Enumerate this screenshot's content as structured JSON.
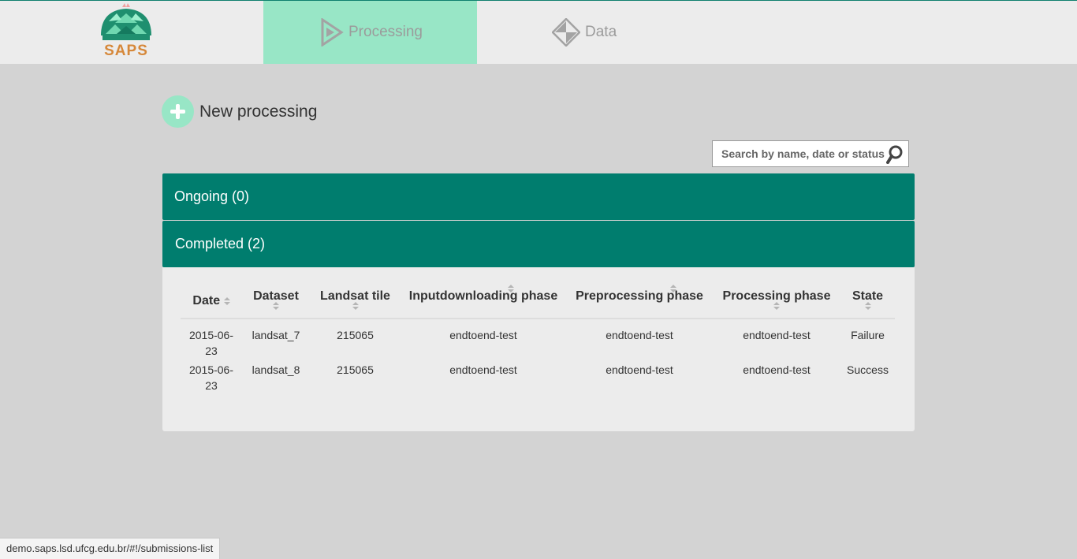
{
  "app": {
    "logo_text": "SAPS",
    "nav": {
      "processing_label": "Processing",
      "data_label": "Data"
    }
  },
  "main": {
    "new_processing_label": "New processing",
    "search_placeholder": "Search by name, date or status",
    "ongoing_label": "Ongoing (0)",
    "completed_label": "Completed (2)"
  },
  "table": {
    "headers": [
      "Date",
      "Dataset",
      "Landsat tile",
      "Inputdownloading phase",
      "Preprocessing phase",
      "Processing phase",
      "State"
    ],
    "rows": [
      [
        "2015-06-23",
        "landsat_7",
        "215065",
        "endtoend-test",
        "endtoend-test",
        "endtoend-test",
        "Failure"
      ],
      [
        "2015-06-23",
        "landsat_8",
        "215065",
        "endtoend-test",
        "endtoend-test",
        "endtoend-test",
        "Success"
      ]
    ]
  },
  "status_url": "demo.saps.lsd.ufcg.edu.br/#!/submissions-list",
  "colors": {
    "accent": "#007d6e",
    "active_tab": "#98e6c6",
    "logo_orange": "#d6883a"
  },
  "icons": [
    "saps-logo",
    "processing-play-icon",
    "data-diamond-icon",
    "plus-icon",
    "search-icon",
    "sort-icon"
  ]
}
